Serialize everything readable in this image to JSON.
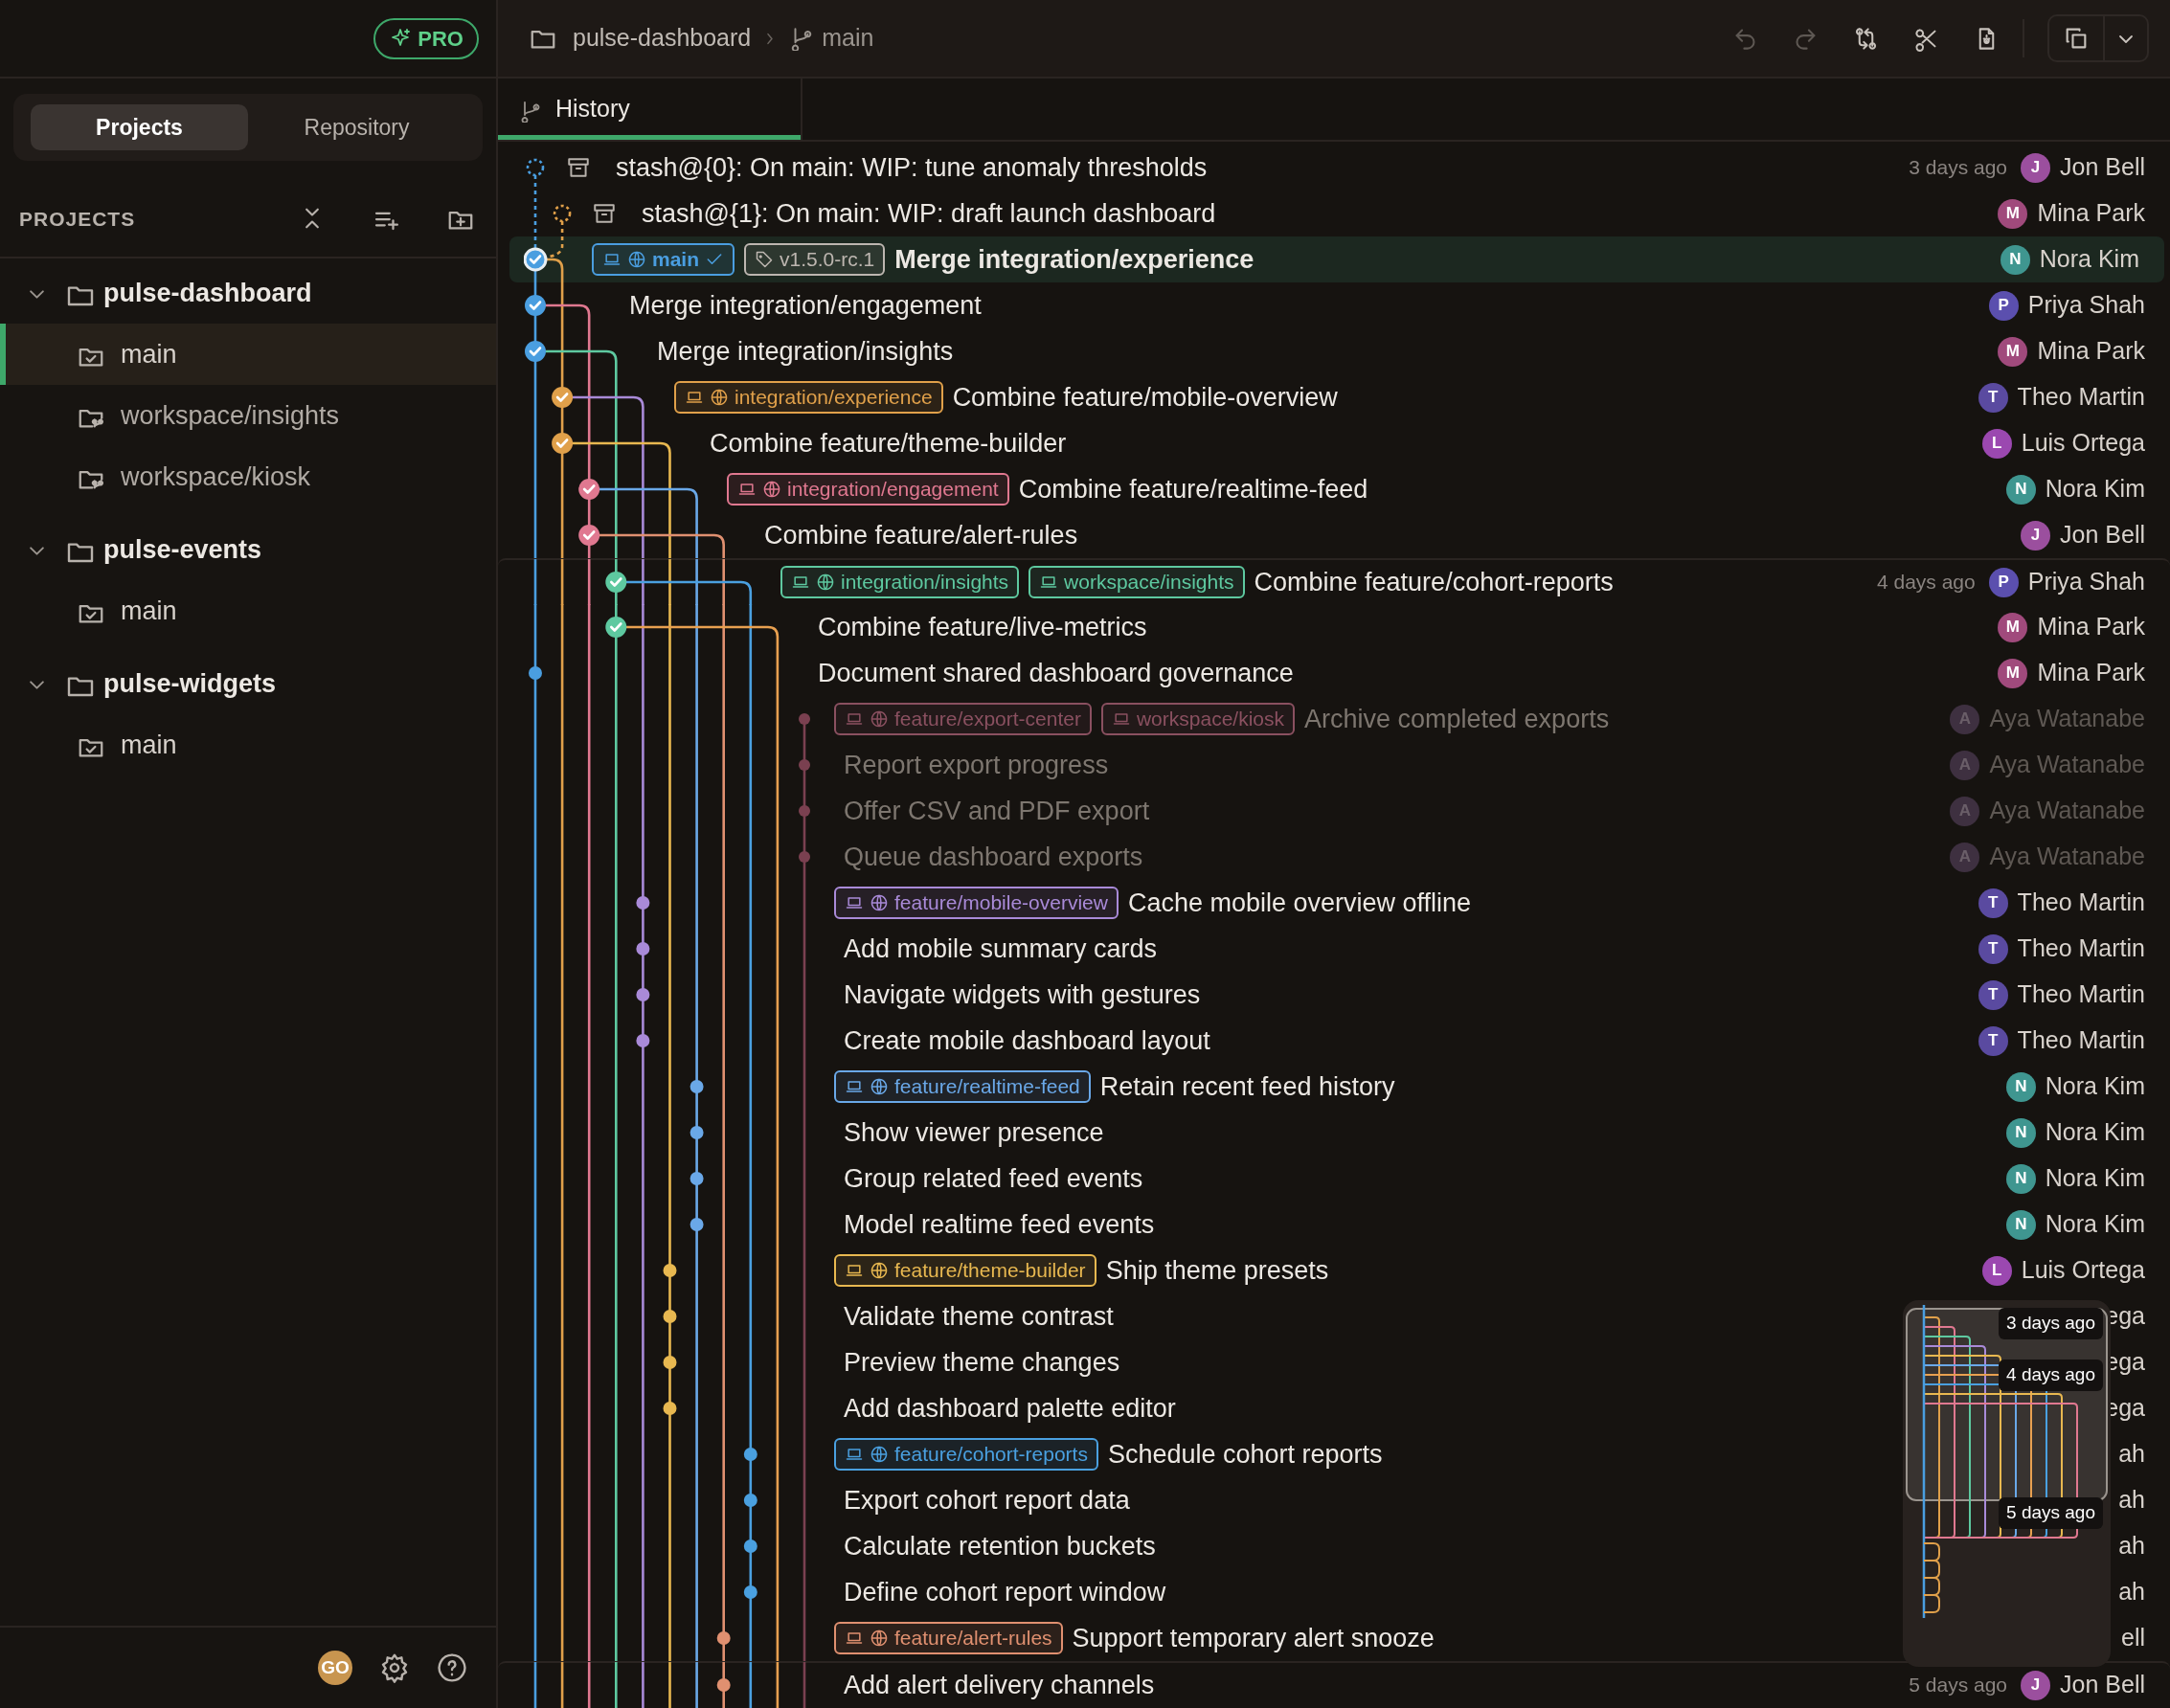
{
  "sidebar": {
    "badge": "PRO",
    "tabs": [
      {
        "label": "Projects",
        "selected": true
      },
      {
        "label": "Repository",
        "selected": false
      }
    ],
    "section_title": "PROJECTS",
    "tree": [
      {
        "label": "pulse-dashboard",
        "kind": "project",
        "expanded": true,
        "selected": false,
        "children": [
          {
            "label": "main",
            "kind": "branch",
            "selected": true
          },
          {
            "label": "workspace/insights",
            "kind": "worktree",
            "selected": false
          },
          {
            "label": "workspace/kiosk",
            "kind": "worktree",
            "selected": false
          }
        ]
      },
      {
        "label": "pulse-events",
        "kind": "project",
        "expanded": true,
        "selected": false,
        "children": [
          {
            "label": "main",
            "kind": "branch",
            "selected": false
          }
        ]
      },
      {
        "label": "pulse-widgets",
        "kind": "project",
        "expanded": true,
        "selected": false,
        "children": [
          {
            "label": "main",
            "kind": "branch",
            "selected": false
          }
        ]
      }
    ],
    "user_initials": "GO"
  },
  "breadcrumb": {
    "project": "pulse-dashboard",
    "branch": "main"
  },
  "toolbar": [
    {
      "kind": "undo",
      "disabled": true
    },
    {
      "kind": "redo",
      "disabled": true
    },
    {
      "kind": "compare",
      "disabled": false
    },
    {
      "kind": "cut",
      "disabled": false
    },
    {
      "kind": "file",
      "disabled": false
    }
  ],
  "tabs": [
    {
      "label": "History",
      "selected": true
    }
  ],
  "commits": [
    {
      "kind": "stash",
      "message": "stash@{0}: On main: WIP: tune anomaly thresholds",
      "date": "3 days ago",
      "initial": "J",
      "author": "Jon Bell",
      "color": "#9b4f9e",
      "dimmed": false,
      "selected": false
    },
    {
      "kind": "stash",
      "message": "stash@{1}: On main: WIP: draft launch dashboard",
      "initial": "M",
      "author": "Mina Park",
      "color": "#a04a7c",
      "dimmed": false,
      "selected": false
    },
    {
      "kind": "merge",
      "message": "Merge integration/experience",
      "refs": [
        {
          "label": "main",
          "kind": "branch",
          "local": true,
          "remote": true,
          "checked_out": true,
          "color": "#4a9ee0"
        },
        {
          "label": "v1.5.0-rc.1",
          "kind": "tag",
          "local": false,
          "remote": false,
          "checked_out": false,
          "color": "#bdb6b0"
        }
      ],
      "initial": "N",
      "author": "Nora Kim",
      "color": "#3f9690",
      "dimmed": false,
      "selected": true
    },
    {
      "kind": "merge",
      "message": "Merge integration/engagement",
      "initial": "P",
      "author": "Priya Shah",
      "color": "#5b4fae",
      "dimmed": false,
      "selected": false
    },
    {
      "kind": "merge",
      "message": "Merge integration/insights",
      "initial": "M",
      "author": "Mina Park",
      "color": "#a04a7c",
      "dimmed": false,
      "selected": false
    },
    {
      "kind": "merge",
      "message": "Combine feature/mobile-overview",
      "refs": [
        {
          "label": "integration/experience",
          "kind": "branch",
          "local": true,
          "remote": true,
          "checked_out": false,
          "color": "#e0a04a"
        }
      ],
      "initial": "T",
      "author": "Theo Martin",
      "color": "#5a4aa0",
      "dimmed": false,
      "selected": false
    },
    {
      "kind": "merge",
      "message": "Combine feature/theme-builder",
      "initial": "L",
      "author": "Luis Ortega",
      "color": "#9b48b0",
      "dimmed": false,
      "selected": false
    },
    {
      "kind": "merge",
      "message": "Combine feature/realtime-feed",
      "refs": [
        {
          "label": "integration/engagement",
          "kind": "branch",
          "local": true,
          "remote": true,
          "checked_out": false,
          "color": "#e07890"
        }
      ],
      "initial": "N",
      "author": "Nora Kim",
      "color": "#3f9690",
      "dimmed": false,
      "selected": false
    },
    {
      "kind": "merge",
      "message": "Combine feature/alert-rules",
      "initial": "J",
      "author": "Jon Bell",
      "color": "#9b4f9e",
      "dimmed": false,
      "selected": false
    },
    {
      "kind": "merge",
      "message": "Combine feature/cohort-reports",
      "refs": [
        {
          "label": "integration/insights",
          "kind": "branch",
          "local": true,
          "remote": true,
          "checked_out": false,
          "color": "#5ec9a0"
        },
        {
          "label": "workspace/insights",
          "kind": "branch",
          "local": true,
          "remote": false,
          "checked_out": false,
          "color": "#5ec9a0"
        }
      ],
      "date": "4 days ago",
      "initial": "P",
      "author": "Priya Shah",
      "color": "#5b4fae",
      "dimmed": false,
      "selected": false
    },
    {
      "kind": "merge",
      "message": "Combine feature/live-metrics",
      "initial": "M",
      "author": "Mina Park",
      "color": "#a04a7c",
      "dimmed": false,
      "selected": false
    },
    {
      "kind": "commit",
      "message": "Document shared dashboard governance",
      "initial": "M",
      "author": "Mina Park",
      "color": "#a04a7c",
      "dimmed": false,
      "selected": false
    },
    {
      "kind": "commit",
      "message": "Archive completed exports",
      "refs": [
        {
          "label": "feature/export-center",
          "kind": "branch",
          "local": true,
          "remote": true,
          "checked_out": false,
          "color": "#8a5060"
        },
        {
          "label": "workspace/kiosk",
          "kind": "branch",
          "local": true,
          "remote": false,
          "checked_out": false,
          "color": "#8a5060"
        }
      ],
      "initial": "A",
      "author": "Aya Watanabe",
      "color": "#3e3040",
      "dimmed": true,
      "selected": false
    },
    {
      "kind": "commit",
      "message": "Report export progress",
      "initial": "A",
      "author": "Aya Watanabe",
      "color": "#3e3040",
      "dimmed": true,
      "selected": false
    },
    {
      "kind": "commit",
      "message": "Offer CSV and PDF export",
      "initial": "A",
      "author": "Aya Watanabe",
      "color": "#3e3040",
      "dimmed": true,
      "selected": false
    },
    {
      "kind": "commit",
      "message": "Queue dashboard exports",
      "initial": "A",
      "author": "Aya Watanabe",
      "color": "#3e3040",
      "dimmed": true,
      "selected": false
    },
    {
      "kind": "commit",
      "message": "Cache mobile overview offline",
      "refs": [
        {
          "label": "feature/mobile-overview",
          "kind": "branch",
          "local": true,
          "remote": true,
          "checked_out": false,
          "color": "#a98ad8"
        }
      ],
      "initial": "T",
      "author": "Theo Martin",
      "color": "#5a4aa0",
      "dimmed": false,
      "selected": false
    },
    {
      "kind": "commit",
      "message": "Add mobile summary cards",
      "initial": "T",
      "author": "Theo Martin",
      "color": "#5a4aa0",
      "dimmed": false,
      "selected": false
    },
    {
      "kind": "commit",
      "message": "Navigate widgets with gestures",
      "initial": "T",
      "author": "Theo Martin",
      "color": "#5a4aa0",
      "dimmed": false,
      "selected": false
    },
    {
      "kind": "commit",
      "message": "Create mobile dashboard layout",
      "initial": "T",
      "author": "Theo Martin",
      "color": "#5a4aa0",
      "dimmed": false,
      "selected": false
    },
    {
      "kind": "commit",
      "message": "Retain recent feed history",
      "refs": [
        {
          "label": "feature/realtime-feed",
          "kind": "branch",
          "local": true,
          "remote": true,
          "checked_out": false,
          "color": "#6aa8e8"
        }
      ],
      "initial": "N",
      "author": "Nora Kim",
      "color": "#3f9690",
      "dimmed": false,
      "selected": false
    },
    {
      "kind": "commit",
      "message": "Show viewer presence",
      "initial": "N",
      "author": "Nora Kim",
      "color": "#3f9690",
      "dimmed": false,
      "selected": false
    },
    {
      "kind": "commit",
      "message": "Group related feed events",
      "initial": "N",
      "author": "Nora Kim",
      "color": "#3f9690",
      "dimmed": false,
      "selected": false
    },
    {
      "kind": "commit",
      "message": "Model realtime feed events",
      "initial": "N",
      "author": "Nora Kim",
      "color": "#3f9690",
      "dimmed": false,
      "selected": false
    },
    {
      "kind": "commit",
      "message": "Ship theme presets",
      "refs": [
        {
          "label": "feature/theme-builder",
          "kind": "branch",
          "local": true,
          "remote": true,
          "checked_out": false,
          "color": "#e8b850"
        }
      ],
      "initial": "L",
      "author": "Luis Ortega",
      "color": "#9b48b0",
      "dimmed": false,
      "selected": false
    },
    {
      "kind": "commit",
      "message": "Validate theme contrast",
      "author": "ega",
      "dimmed": false,
      "selected": false
    },
    {
      "kind": "commit",
      "message": "Preview theme changes",
      "author": "ega",
      "dimmed": false,
      "selected": false
    },
    {
      "kind": "commit",
      "message": "Add dashboard palette editor",
      "author": "ega",
      "dimmed": false,
      "selected": false
    },
    {
      "kind": "commit",
      "message": "Schedule cohort reports",
      "refs": [
        {
          "label": "feature/cohort-reports",
          "kind": "branch",
          "local": true,
          "remote": true,
          "checked_out": false,
          "color": "#4aa0e0"
        }
      ],
      "author": "ah",
      "dimmed": false,
      "selected": false
    },
    {
      "kind": "commit",
      "message": "Export cohort report data",
      "author": "ah",
      "dimmed": false,
      "selected": false
    },
    {
      "kind": "commit",
      "message": "Calculate retention buckets",
      "author": "ah",
      "dimmed": false,
      "selected": false
    },
    {
      "kind": "commit",
      "message": "Define cohort report window",
      "author": "ah",
      "dimmed": false,
      "selected": false
    },
    {
      "kind": "commit",
      "message": "Support temporary alert snooze",
      "refs": [
        {
          "label": "feature/alert-rules",
          "kind": "branch",
          "local": true,
          "remote": true,
          "checked_out": false,
          "color": "#e09070"
        }
      ],
      "author": "ell",
      "dimmed": false,
      "selected": false
    },
    {
      "kind": "commit",
      "message": "Add alert delivery channels",
      "date": "5 days ago",
      "initial": "J",
      "author": "Jon Bell",
      "color": "#9b4f9e",
      "dimmed": false,
      "selected": false
    }
  ],
  "minimap": {
    "labels": [
      "3 days ago",
      "4 days ago",
      "5 days ago"
    ]
  }
}
